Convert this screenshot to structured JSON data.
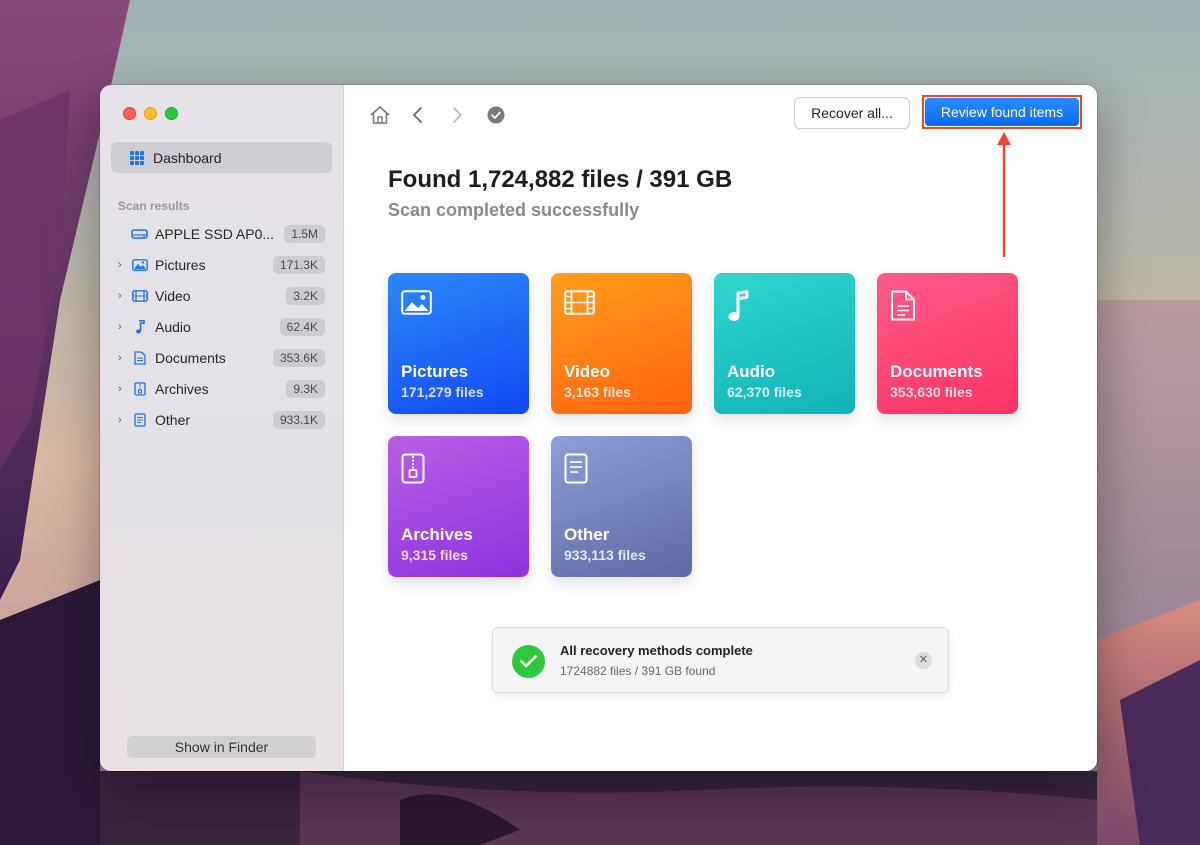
{
  "colors": {
    "accent": "#0a6cf5",
    "highlight_border": "#e8462f",
    "success": "#2dc83b"
  },
  "sidebar": {
    "dashboard_label": "Dashboard",
    "section_label": "Scan results",
    "items": [
      {
        "label": "APPLE SSD AP0...",
        "badge": "1.5M",
        "icon": "drive-icon",
        "expandable": false
      },
      {
        "label": "Pictures",
        "badge": "171.3K",
        "icon": "picture-icon",
        "expandable": true
      },
      {
        "label": "Video",
        "badge": "3.2K",
        "icon": "film-icon",
        "expandable": true
      },
      {
        "label": "Audio",
        "badge": "62.4K",
        "icon": "music-note-icon",
        "expandable": true
      },
      {
        "label": "Documents",
        "badge": "353.6K",
        "icon": "document-icon",
        "expandable": true
      },
      {
        "label": "Archives",
        "badge": "9.3K",
        "icon": "archive-icon",
        "expandable": true
      },
      {
        "label": "Other",
        "badge": "933.1K",
        "icon": "file-icon",
        "expandable": true
      }
    ],
    "show_in_finder_label": "Show in Finder"
  },
  "toolbar": {
    "recover_all_label": "Recover all...",
    "review_label": "Review found items"
  },
  "main": {
    "title": "Found 1,724,882 files / 391 GB",
    "subtitle": "Scan completed successfully",
    "cards": [
      {
        "name": "Pictures",
        "count": "171,279 files",
        "icon": "picture-icon"
      },
      {
        "name": "Video",
        "count": "3,163 files",
        "icon": "film-icon"
      },
      {
        "name": "Audio",
        "count": "62,370 files",
        "icon": "music-note-icon"
      },
      {
        "name": "Documents",
        "count": "353,630 files",
        "icon": "document-icon"
      },
      {
        "name": "Archives",
        "count": "9,315 files",
        "icon": "archive-icon"
      },
      {
        "name": "Other",
        "count": "933,113 files",
        "icon": "file-icon"
      }
    ]
  },
  "notification": {
    "title": "All recovery methods complete",
    "subtitle": "1724882 files / 391 GB found"
  }
}
